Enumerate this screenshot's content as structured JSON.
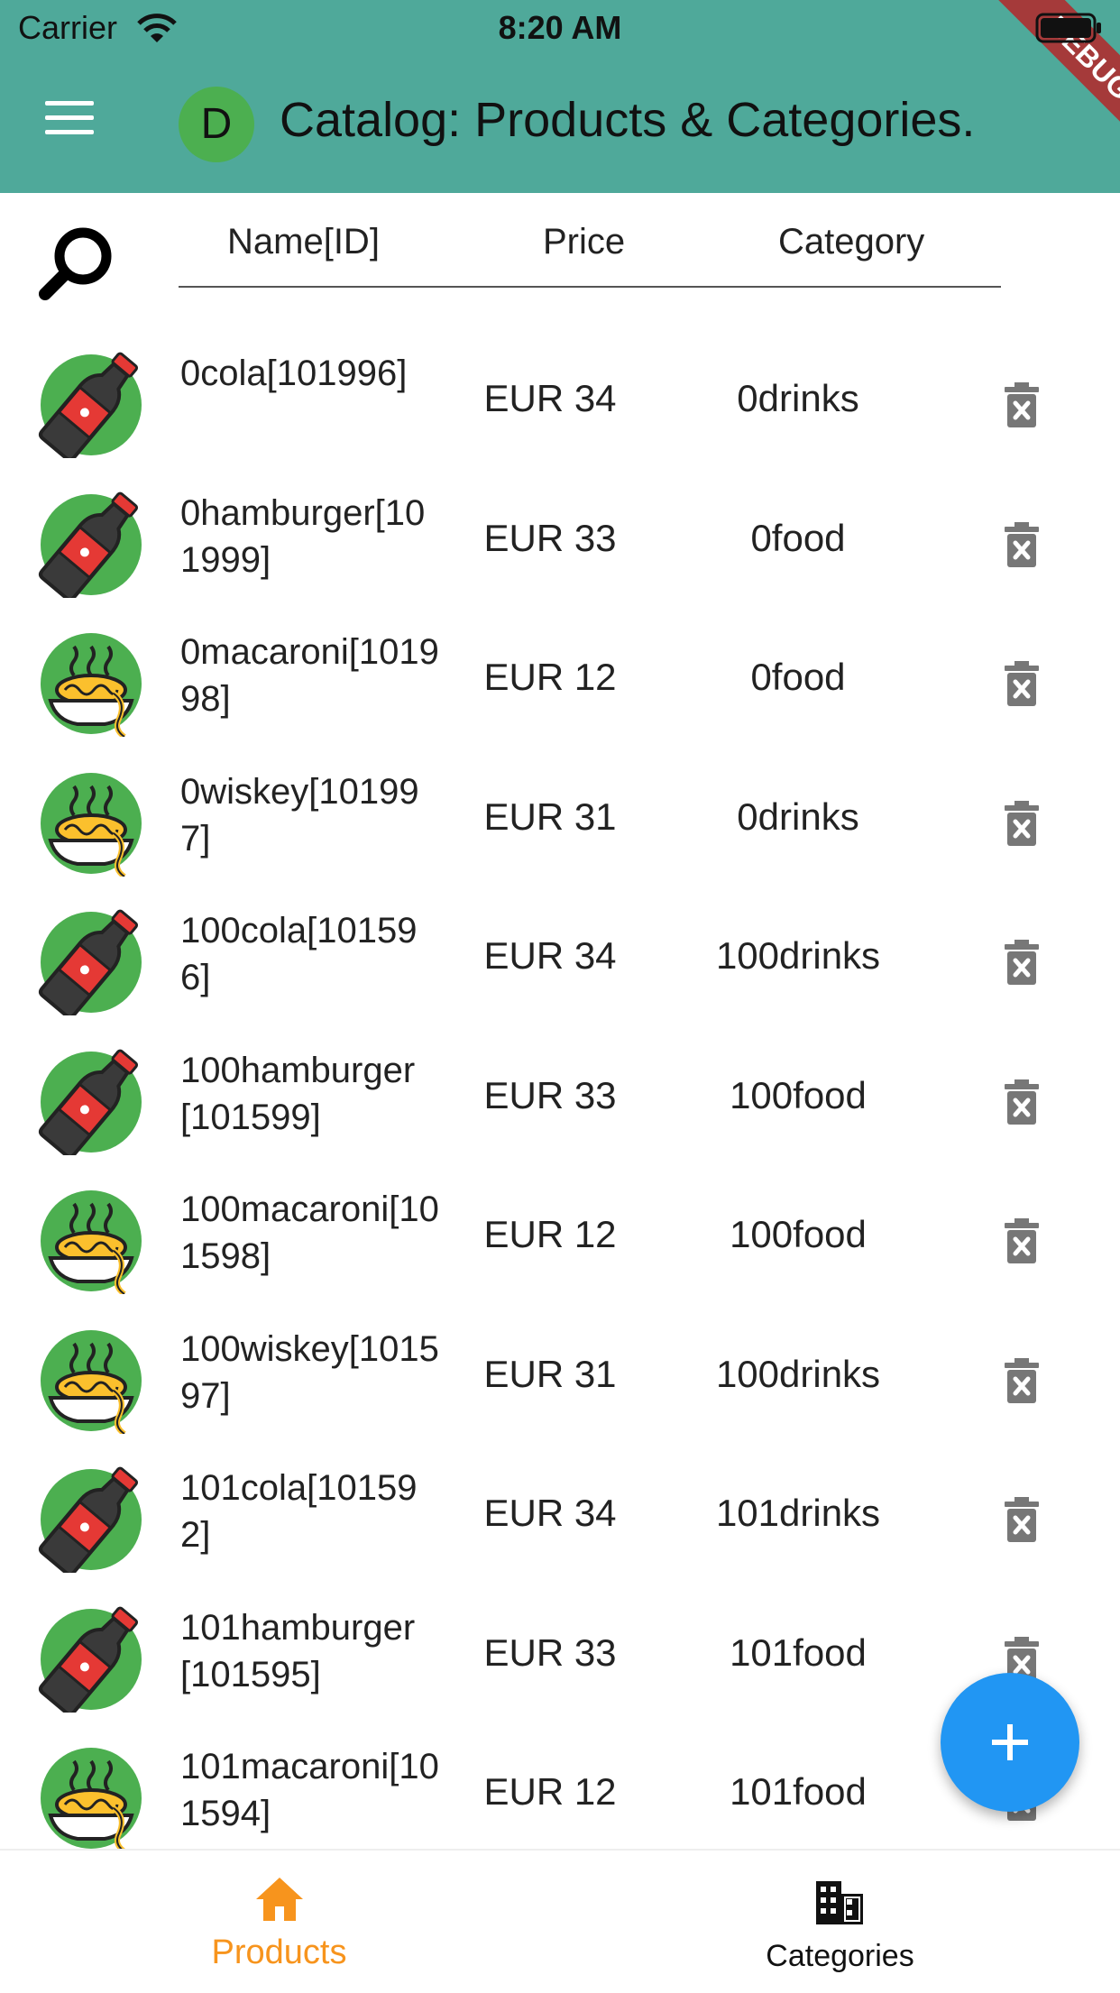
{
  "status": {
    "carrier": "Carrier",
    "time": "8:20 AM"
  },
  "appbar": {
    "avatar_letter": "D",
    "title": "Catalog: Products & Categories.",
    "debug_label": "DEBUG",
    "color": "#4fa99a"
  },
  "table": {
    "headers": {
      "name": "Name[ID]",
      "price": "Price",
      "category": "Category"
    },
    "rows": [
      {
        "name": "0cola[101996]",
        "price": "EUR 34",
        "category": "0drinks",
        "icon": "cola-bottle-icon"
      },
      {
        "name": "0hamburger[101999]",
        "price": "EUR 33",
        "category": "0food",
        "icon": "cola-bottle-icon"
      },
      {
        "name": "0macaroni[101998]",
        "price": "EUR 12",
        "category": "0food",
        "icon": "noodle-bowl-icon"
      },
      {
        "name": "0wiskey[101997]",
        "price": "EUR 31",
        "category": "0drinks",
        "icon": "noodle-bowl-icon"
      },
      {
        "name": "100cola[101596]",
        "price": "EUR 34",
        "category": "100drinks",
        "icon": "cola-bottle-icon"
      },
      {
        "name": "100hamburger[101599]",
        "price": "EUR 33",
        "category": "100food",
        "icon": "cola-bottle-icon"
      },
      {
        "name": "100macaroni[101598]",
        "price": "EUR 12",
        "category": "100food",
        "icon": "noodle-bowl-icon"
      },
      {
        "name": "100wiskey[101597]",
        "price": "EUR 31",
        "category": "100drinks",
        "icon": "noodle-bowl-icon"
      },
      {
        "name": "101cola[101592]",
        "price": "EUR 34",
        "category": "101drinks",
        "icon": "cola-bottle-icon"
      },
      {
        "name": "101hamburger[101595]",
        "price": "EUR 33",
        "category": "101food",
        "icon": "cola-bottle-icon"
      },
      {
        "name": "101macaroni[101594]",
        "price": "EUR 12",
        "category": "101food",
        "icon": "noodle-bowl-icon"
      }
    ]
  },
  "fab": {
    "icon": "plus-icon",
    "color": "#2196f3"
  },
  "bottom_nav": {
    "items": [
      {
        "label": "Products",
        "icon": "home-icon",
        "active": true,
        "color": "#f7941d"
      },
      {
        "label": "Categories",
        "icon": "building-icon",
        "active": false,
        "color": "#111111"
      }
    ]
  }
}
